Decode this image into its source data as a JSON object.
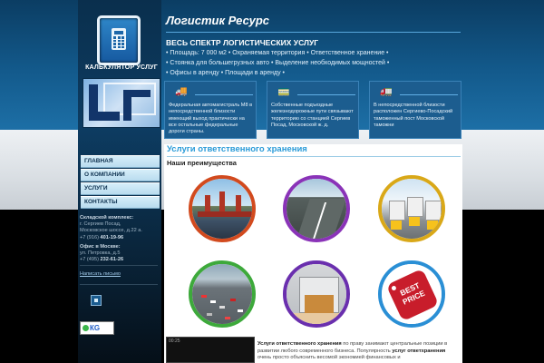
{
  "calculator": {
    "label": "КАЛЬКУЛЯТОР УСЛУГ",
    "icon": "calculator-icon"
  },
  "logo": {
    "icon": "company-logo"
  },
  "header": {
    "title": "Логистик Ресурс",
    "headline": "ВЕСЬ СПЕКТР ЛОГИСТИЧЕСКИХ УСЛУГ",
    "bullets": [
      "• Площадь: 7 000 м2",
      "• Охраняемая территория",
      "• Ответственное хранение •",
      "• Стоянка для большегрузных авто",
      "• Выделение необходимых мощностей •",
      "• Офисы в аренду",
      "• Площади в аренду •"
    ]
  },
  "services": [
    {
      "icon": "truck-icon",
      "text": "Федеральная автомагистраль М8 в непосредственной близости имеющий выход практически на все остальные федеральные дороги страны."
    },
    {
      "icon": "railcar-icon",
      "text": "Собственные подъездные железнодорожные пути связывают территорию со станцией Сергиев Посад, Московской ж. д."
    },
    {
      "icon": "customs-icon",
      "text": "В непосредственной близости расположен Сергиево-Посадский таможенный пост Московской таможни"
    }
  ],
  "nav": {
    "items": [
      "Главная",
      "О компании",
      "Услуги",
      "Контакты"
    ]
  },
  "contact": {
    "warehouse_head": "Складской комплекс:",
    "warehouse_addr1": "г. Сергиев Посад,",
    "warehouse_addr2": "Московское шоссе, д.22 а.",
    "warehouse_phone_prefix": "+7 (916) ",
    "warehouse_phone_main": "401-19-96",
    "office_head": "Офис в Москве:",
    "office_addr": "ул. Петровка, д.5",
    "office_phone_prefix": "+7 (495) ",
    "office_phone_main": "232-61-26",
    "write_link": "Написать письмо"
  },
  "counters": {
    "second_label": "КG"
  },
  "main": {
    "title": "Услуги ответственного хранения",
    "subtitle": "Наши преимущества",
    "images": [
      {
        "icon": "kremlin-photo"
      },
      {
        "icon": "highway-photo"
      },
      {
        "icon": "trucks-photo"
      },
      {
        "icon": "traffic-photo"
      },
      {
        "icon": "warehouse-gate-photo"
      },
      {
        "icon": "best-price-tag"
      }
    ],
    "price_tag": "BEST\nPRICE",
    "video_time": "00:25",
    "text_bold1": "Услуги ответственного хранения",
    "text_part1": " по праву занимают центральные позиции в развитии любого современного бизнеса. Популярность ",
    "text_bold2": "услуг ответхранения",
    "text_part2": " очень просто объяснить весомой экономией финансовых и"
  },
  "colors": {
    "header_bg": "#135a8c",
    "accent": "#2a9bd8",
    "nav_bg": "#c7e5f4"
  }
}
